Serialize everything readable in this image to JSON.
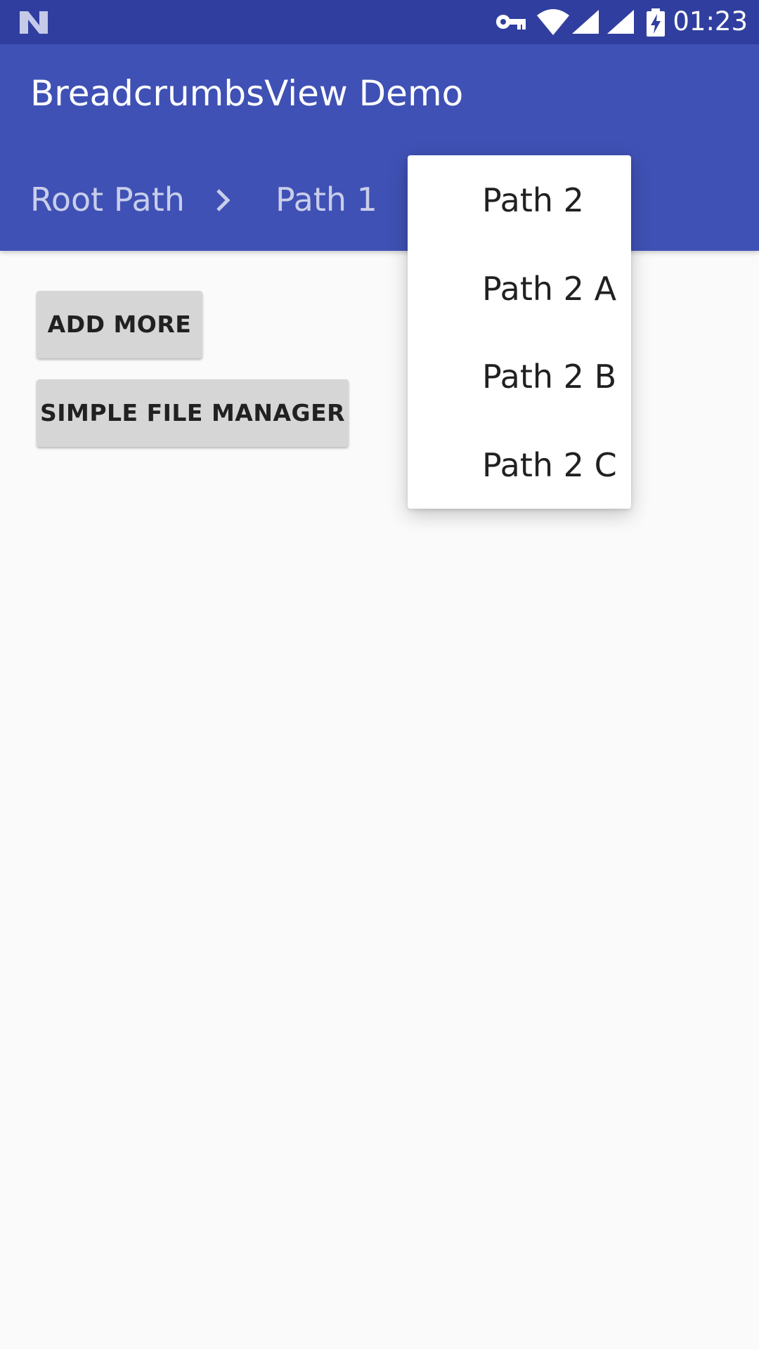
{
  "status_bar": {
    "time": "01:23",
    "icons": [
      "notification-n-icon",
      "vpn-key-icon",
      "wifi-icon",
      "signal-icon",
      "signal-icon",
      "battery-charging-icon"
    ]
  },
  "app_bar": {
    "title": "BreadcrumbsView Demo",
    "breadcrumbs": [
      "Root Path",
      "Path 1"
    ],
    "separator_icon": "chevron-right-icon"
  },
  "buttons": {
    "add_more": "ADD MORE",
    "simple_file_manager": "SIMPLE FILE MANAGER"
  },
  "dropdown": {
    "items": [
      "Path 2",
      "Path 2 A",
      "Path 2 B",
      "Path 2 C"
    ]
  },
  "colors": {
    "primary": "#3f51b5",
    "primary_dark": "#303f9f",
    "background": "#fafafa",
    "button": "#d6d6d6"
  }
}
